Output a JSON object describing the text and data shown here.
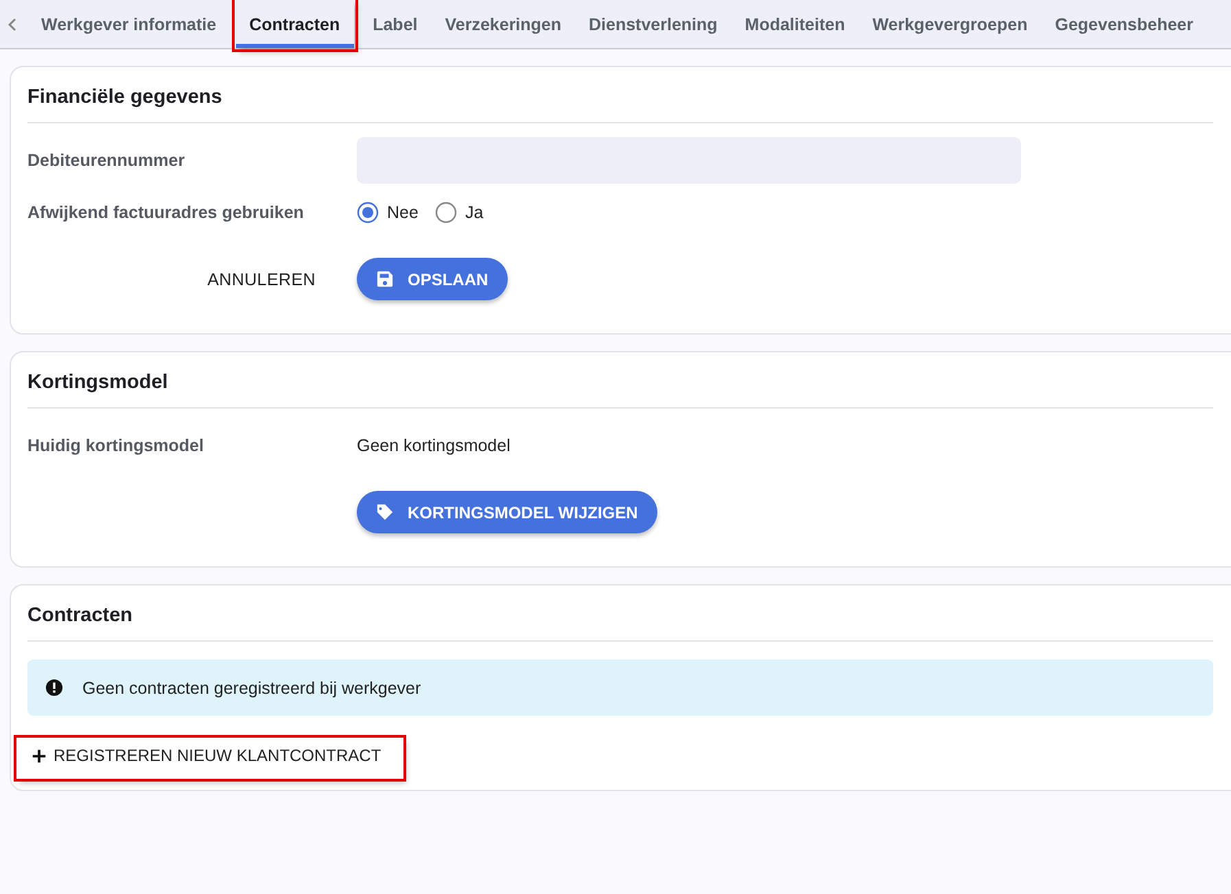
{
  "tabs": [
    {
      "label": "Werkgever informatie",
      "selected": false,
      "highlighted": false
    },
    {
      "label": "Contracten",
      "selected": true,
      "highlighted": true
    },
    {
      "label": "Label",
      "selected": false,
      "highlighted": false
    },
    {
      "label": "Verzekeringen",
      "selected": false,
      "highlighted": false
    },
    {
      "label": "Dienstverlening",
      "selected": false,
      "highlighted": false
    },
    {
      "label": "Modaliteiten",
      "selected": false,
      "highlighted": false
    },
    {
      "label": "Werkgevergroepen",
      "selected": false,
      "highlighted": false
    },
    {
      "label": "Gegevensbeheer",
      "selected": false,
      "highlighted": false
    }
  ],
  "sections": [
    {
      "title": "Financiële gegevens",
      "fields": [
        {
          "kind": "input",
          "label": "Debiteurennummer"
        },
        {
          "kind": "radio",
          "label": "Afwijkend factuuradres gebruiken",
          "options": [
            {
              "label": "Nee",
              "selected": true
            },
            {
              "label": "Ja",
              "selected": false
            }
          ]
        }
      ],
      "actions": [
        {
          "kind": "text",
          "label": "ANNULEREN"
        },
        {
          "kind": "save",
          "label": "OPSLAAN"
        }
      ]
    },
    {
      "title": "Kortingsmodel",
      "fields": [
        {
          "kind": "text",
          "label": "Huidig kortingsmodel",
          "value": "Geen kortingsmodel"
        }
      ],
      "actions": [
        {
          "kind": "tag",
          "label": "KORTINGSMODEL WIJZIGEN"
        }
      ]
    },
    {
      "title": "Contracten",
      "alert": {
        "text": "Geen contracten geregistreerd bij werkgever"
      },
      "add_button": {
        "label": "REGISTREREN NIEUW KLANTCONTRACT",
        "highlighted": true
      }
    }
  ]
}
